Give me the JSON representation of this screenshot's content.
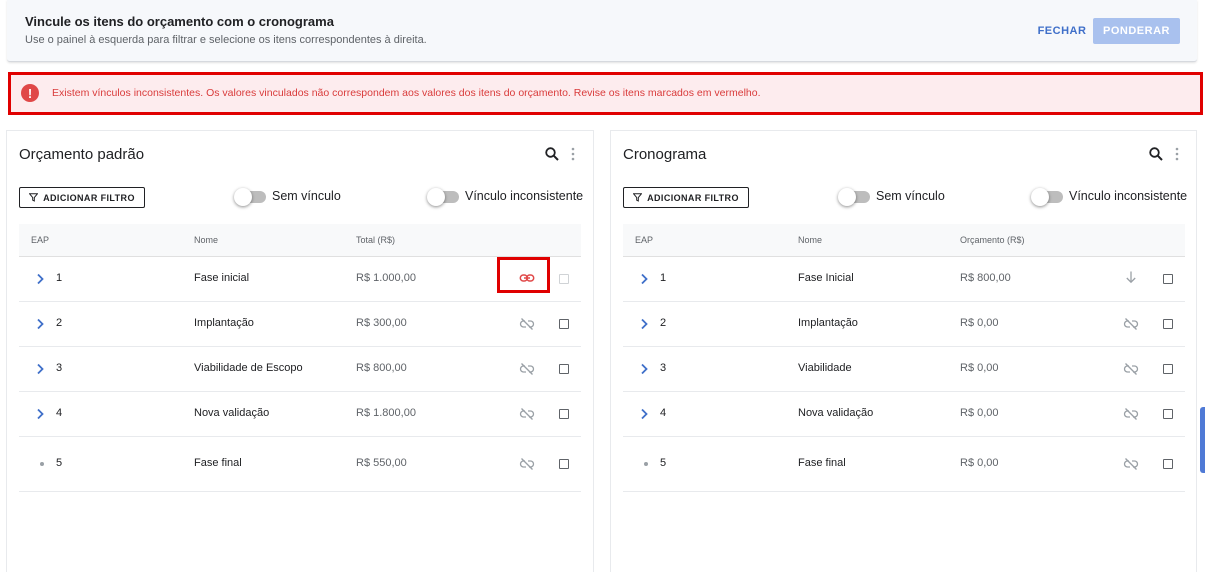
{
  "header": {
    "title": "Vincule os itens do orçamento com o cronograma",
    "subtitle": "Use o painel à esquerda para filtrar e selecione os itens correspondentes à direita.",
    "close_label": "FECHAR",
    "ponderar_label": "PONDERAR"
  },
  "alert": {
    "icon": "!",
    "message": "Existem vínculos inconsistentes. Os valores vinculados não correspondem aos valores dos itens do orçamento. Revise os itens marcados em vermelho."
  },
  "left": {
    "title": "Orçamento padrão",
    "filter_label": "ADICIONAR FILTRO",
    "toggle1": "Sem vínculo",
    "toggle2": "Vínculo inconsistente",
    "columns": [
      "EAP",
      "Nome",
      "Total (R$)"
    ],
    "rows": [
      {
        "eap": "1",
        "nome": "Fase inicial",
        "valor": "R$ 1.000,00",
        "status": "linked"
      },
      {
        "eap": "2",
        "nome": "Implantação",
        "valor": "R$ 300,00",
        "status": "unlinked"
      },
      {
        "eap": "3",
        "nome": "Viabilidade de Escopo",
        "valor": "R$ 800,00",
        "status": "unlinked"
      },
      {
        "eap": "4",
        "nome": "Nova validação",
        "valor": "R$ 1.800,00",
        "status": "unlinked"
      },
      {
        "eap": "5",
        "nome": "Fase final",
        "valor": "R$ 550,00",
        "status": "unlinked"
      }
    ]
  },
  "right": {
    "title": "Cronograma",
    "filter_label": "ADICIONAR FILTRO",
    "toggle1": "Sem vínculo",
    "toggle2": "Vínculo inconsistente",
    "columns": [
      "EAP",
      "Nome",
      "Orçamento (R$)"
    ],
    "rows": [
      {
        "eap": "1",
        "nome": "Fase Inicial",
        "valor": "R$ 800,00",
        "status": "arrow"
      },
      {
        "eap": "2",
        "nome": "Implantação",
        "valor": "R$ 0,00",
        "status": "unlinked"
      },
      {
        "eap": "3",
        "nome": "Viabilidade",
        "valor": "R$ 0,00",
        "status": "unlinked"
      },
      {
        "eap": "4",
        "nome": "Nova validação",
        "valor": "R$ 0,00",
        "status": "unlinked"
      },
      {
        "eap": "5",
        "nome": "Fase final",
        "valor": "R$ 0,00",
        "status": "unlinked"
      }
    ]
  },
  "colors": {
    "accent": "#3f6fc9",
    "error": "#e00000",
    "link_red": "#e04848",
    "icon_gray": "#9aa0a6"
  }
}
